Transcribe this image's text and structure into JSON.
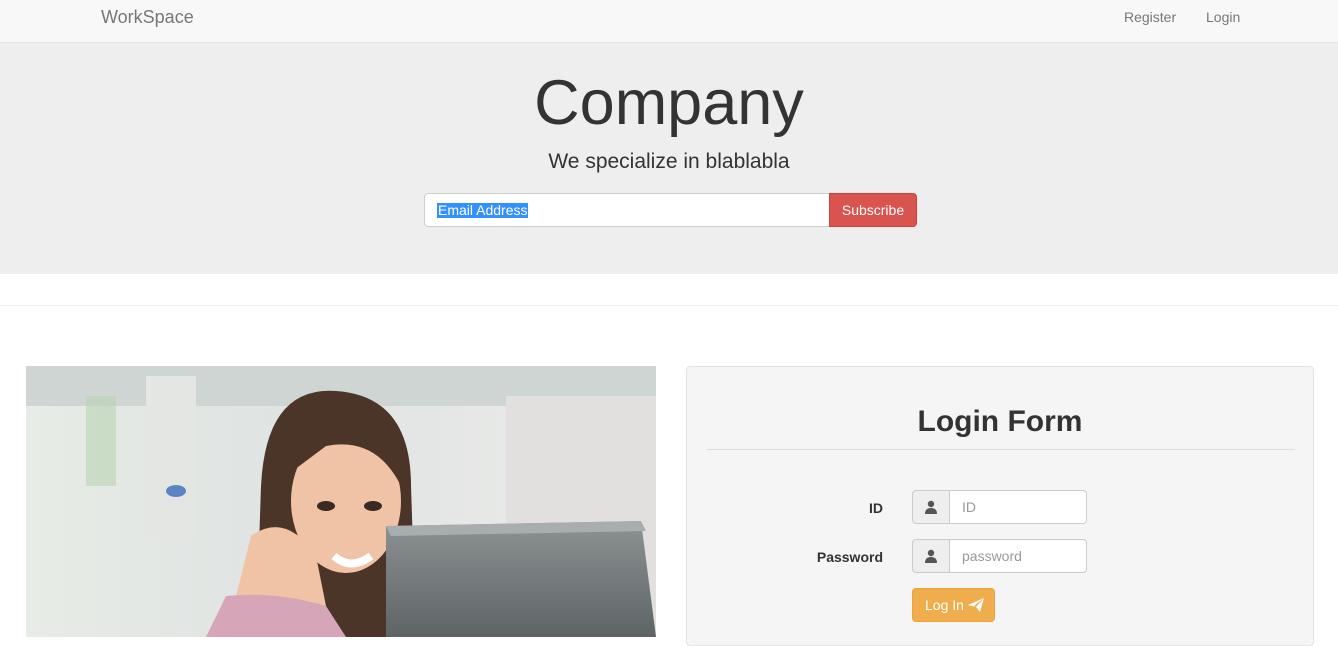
{
  "navbar": {
    "brand": "WorkSpace",
    "links": {
      "register": "Register",
      "login": "Login"
    }
  },
  "hero": {
    "title": "Company",
    "subtitle": "We specialize in blablabla",
    "email_value": "Email Address",
    "subscribe_label": "Subscribe"
  },
  "photo": {
    "icon": "woman-with-laptop-photo"
  },
  "login_form": {
    "title": "Login Form",
    "id_label": "ID",
    "id_placeholder": "ID",
    "id_icon": "user-icon",
    "password_label": "Password",
    "password_placeholder": "password",
    "password_icon": "user-icon",
    "submit_label": "Log In",
    "submit_icon": "send-icon"
  },
  "colors": {
    "subscribe": "#d9534f",
    "login_button": "#f0ad4e",
    "selection": "#3390ff",
    "jumbotron": "#eeeeee"
  }
}
